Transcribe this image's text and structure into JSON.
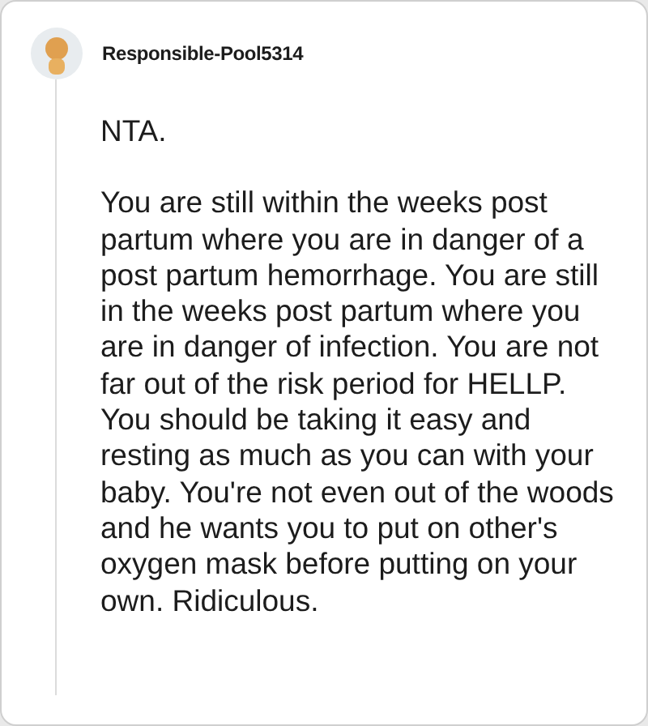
{
  "comment": {
    "author": "Responsible-Pool5314",
    "paragraphs": [
      "NTA.",
      "You are still within the weeks post partum where you are in danger of a post partum hemorrhage. You are still in the weeks post partum where you are in danger of infection. You are not far out of the risk period for HELLP. You should be taking it easy and resting as much as you can with your baby. You're not even out of the woods and he wants you to put on other's oxygen mask before putting on your own. Ridiculous."
    ]
  }
}
